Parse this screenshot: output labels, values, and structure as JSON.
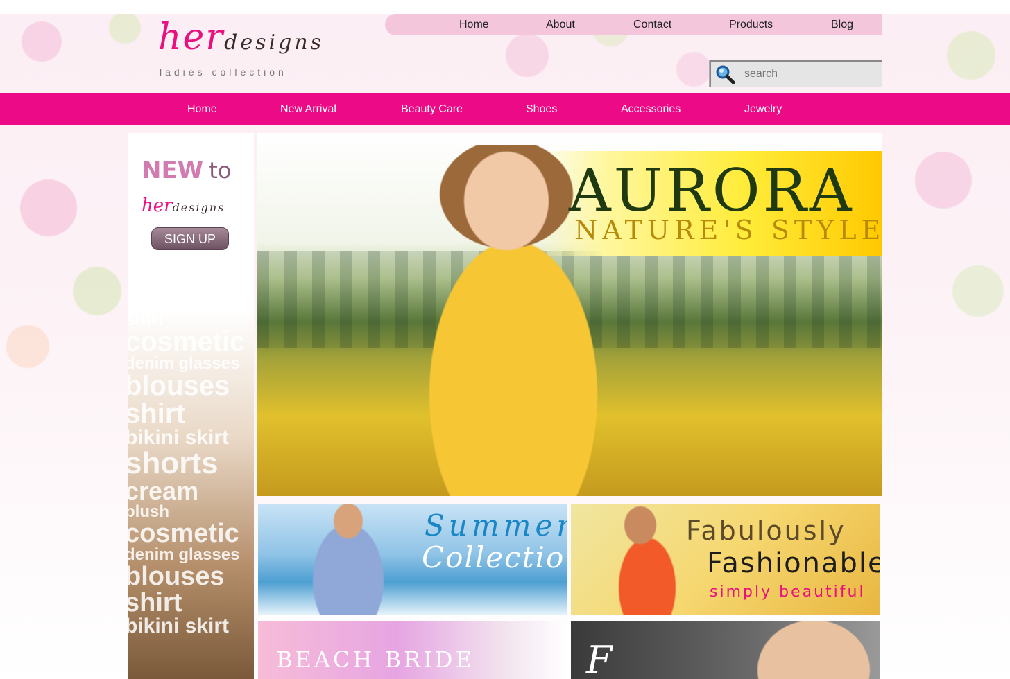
{
  "top_nav": [
    "Home",
    "About",
    "Contact",
    "Products",
    "Blog"
  ],
  "logo": {
    "her": "her",
    "designs": "designs",
    "tagline": "ladies collection"
  },
  "search": {
    "placeholder": "search"
  },
  "category_nav": [
    "Home",
    "New Arrival",
    "Beauty Care",
    "Shoes",
    "Accessories",
    "Jewelry"
  ],
  "sidebar": {
    "new_text": "NEW",
    "to_text": "to",
    "logo_her": "her",
    "logo_designs": "designs",
    "signup_label": "SIGN UP",
    "word_cloud": [
      "shirt",
      "cosmetic",
      "denim glasses",
      "blouses",
      "shirt",
      "bikini skirt",
      "shorts",
      "cream",
      "blush",
      "cosmetic",
      "denim glasses",
      "blouses",
      "shirt",
      "bikini skirt"
    ]
  },
  "hero": {
    "title": "AURORA",
    "subtitle": "NATURE'S STYLE"
  },
  "tiles": {
    "summer": {
      "line1": "Summer",
      "line2": "Collection"
    },
    "fabulous": {
      "line1": "Fabulously",
      "line2": "Fashionable",
      "line3": "simply beautiful"
    },
    "beach": {
      "line1": "BEACH BRIDE"
    },
    "fashion": {
      "line1": "F"
    }
  },
  "colors": {
    "brand_pink": "#ec0a86",
    "topnav_bg": "#f4c6dc",
    "signup_bg": "#7d6272"
  },
  "icons": {
    "search": "magnifier-icon"
  }
}
